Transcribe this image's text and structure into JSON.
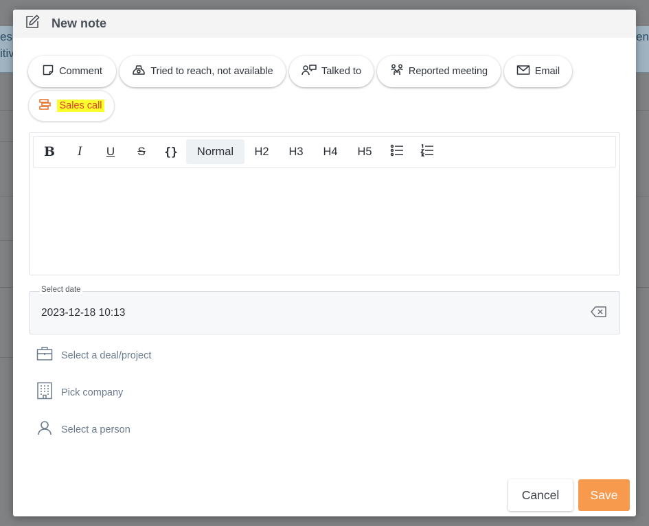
{
  "background": {
    "left_text_top": "es",
    "left_text_bottom": "itiv",
    "right_text": "en"
  },
  "dialog": {
    "title": "New note",
    "title_icon": "edit-note-icon"
  },
  "note_types": [
    {
      "label": "Comment",
      "icon": "sticky-note-icon"
    },
    {
      "label": "Tried to reach, not available",
      "icon": "phone-missed-icon"
    },
    {
      "label": "Talked to",
      "icon": "person-chat-icon"
    },
    {
      "label": "Reported meeting",
      "icon": "meeting-icon"
    },
    {
      "label": "Email",
      "icon": "envelope-icon"
    },
    {
      "label": "Sales call",
      "icon": "sales-call-icon",
      "highlight": "#fbff2b",
      "text_color": "#e23b2e"
    }
  ],
  "editor": {
    "bold": "B",
    "italic": "I",
    "underline": "U",
    "strike": "S",
    "code": "{}",
    "normal": "Normal",
    "h2": "H2",
    "h3": "H3",
    "h4": "H4",
    "h5": "H5",
    "content": ""
  },
  "date": {
    "label": "Select date",
    "value": "2023-12-18 10:13"
  },
  "selectors": {
    "deal": "Select a deal/project",
    "company": "Pick company",
    "person": "Select a person"
  },
  "actions": {
    "cancel": "Cancel",
    "save": "Save"
  },
  "colors": {
    "save_button": "#f79a4d",
    "muted_text": "#6b7a8c",
    "highlight": "#fbff2b"
  }
}
